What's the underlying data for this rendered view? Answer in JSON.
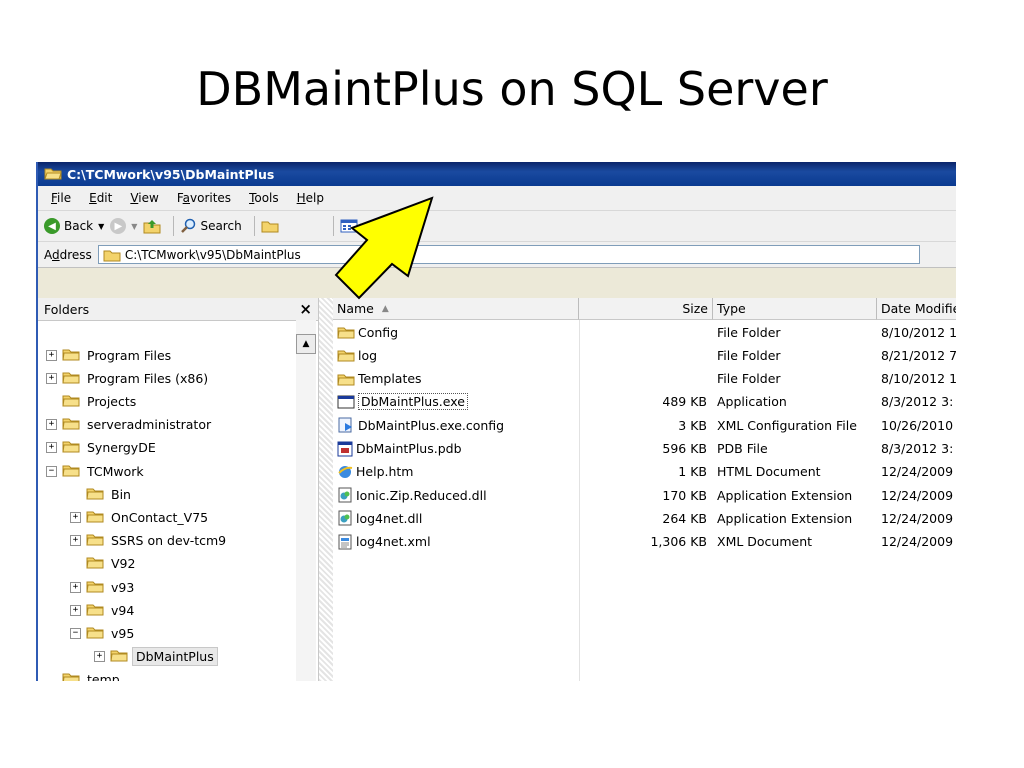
{
  "slide": {
    "title": "DBMaintPlus on SQL Server"
  },
  "window": {
    "title": "C:\\TCMwork\\v95\\DbMaintPlus"
  },
  "menu": {
    "items": [
      {
        "pre": "",
        "key": "F",
        "post": "ile"
      },
      {
        "pre": "",
        "key": "E",
        "post": "dit"
      },
      {
        "pre": "",
        "key": "V",
        "post": "iew"
      },
      {
        "pre": "F",
        "key": "a",
        "post": "vorites"
      },
      {
        "pre": "",
        "key": "T",
        "post": "ools"
      },
      {
        "pre": "",
        "key": "H",
        "post": "elp"
      }
    ]
  },
  "toolbar": {
    "back_label": "Back",
    "search_label": "Search"
  },
  "address": {
    "label": "Address",
    "value": "C:\\TCMwork\\v95\\DbMaintPlus"
  },
  "folders": {
    "header": "Folders",
    "close_glyph": "×",
    "items": [
      {
        "label": "Program Files",
        "expander": "+",
        "indent": 0
      },
      {
        "label": "Program Files (x86)",
        "expander": "+",
        "indent": 0
      },
      {
        "label": "Projects",
        "expander": "",
        "indent": 0
      },
      {
        "label": "serveradministrator",
        "expander": "+",
        "indent": 0
      },
      {
        "label": "SynergyDE",
        "expander": "+",
        "indent": 0
      },
      {
        "label": "TCMwork",
        "expander": "−",
        "indent": 0
      },
      {
        "label": "Bin",
        "expander": "",
        "indent": 1
      },
      {
        "label": "OnContact_V75",
        "expander": "+",
        "indent": 1
      },
      {
        "label": "SSRS on dev-tcm9",
        "expander": "+",
        "indent": 1
      },
      {
        "label": "V92",
        "expander": "",
        "indent": 1
      },
      {
        "label": "v93",
        "expander": "+",
        "indent": 1
      },
      {
        "label": "v94",
        "expander": "+",
        "indent": 1
      },
      {
        "label": "v95",
        "expander": "−",
        "indent": 1
      },
      {
        "label": "DbMaintPlus",
        "expander": "+",
        "indent": 2,
        "selected": true
      },
      {
        "label": "temp",
        "expander": "",
        "indent": 0
      }
    ]
  },
  "columns": {
    "name": "Name",
    "size": "Size",
    "type": "Type",
    "date": "Date Modifie"
  },
  "files": [
    {
      "name": "Config",
      "size": "",
      "type": "File Folder",
      "date": "8/10/2012 1",
      "icon": "folder-icon"
    },
    {
      "name": "log",
      "size": "",
      "type": "File Folder",
      "date": "8/21/2012 7",
      "icon": "folder-icon"
    },
    {
      "name": "Templates",
      "size": "",
      "type": "File Folder",
      "date": "8/10/2012 1",
      "icon": "folder-icon"
    },
    {
      "name": "DbMaintPlus.exe",
      "size": "489 KB",
      "type": "Application",
      "date": "8/3/2012 3:",
      "icon": "application-icon"
    },
    {
      "name": "DbMaintPlus.exe.config",
      "size": "3 KB",
      "type": "XML Configuration File",
      "date": "10/26/2010",
      "icon": "config-file-icon"
    },
    {
      "name": "DbMaintPlus.pdb",
      "size": "596 KB",
      "type": "PDB File",
      "date": "8/3/2012 3:",
      "icon": "pdb-file-icon"
    },
    {
      "name": "Help.htm",
      "size": "1 KB",
      "type": "HTML Document",
      "date": "12/24/2009",
      "icon": "html-document-icon"
    },
    {
      "name": "Ionic.Zip.Reduced.dll",
      "size": "170 KB",
      "type": "Application Extension",
      "date": "12/24/2009",
      "icon": "dll-icon"
    },
    {
      "name": "log4net.dll",
      "size": "264 KB",
      "type": "Application Extension",
      "date": "12/24/2009",
      "icon": "dll-icon"
    },
    {
      "name": "log4net.xml",
      "size": "1,306 KB",
      "type": "XML Document",
      "date": "12/24/2009",
      "icon": "xml-document-icon"
    }
  ],
  "annotation": {
    "arrow_color": "#ffff00",
    "arrow_target": "address-path",
    "arrow_icon": "yellow-arrow-icon"
  },
  "colors": {
    "titlebar": "#0a246a",
    "folder": "#f3d36b",
    "window_border": "#2f5bb4"
  }
}
